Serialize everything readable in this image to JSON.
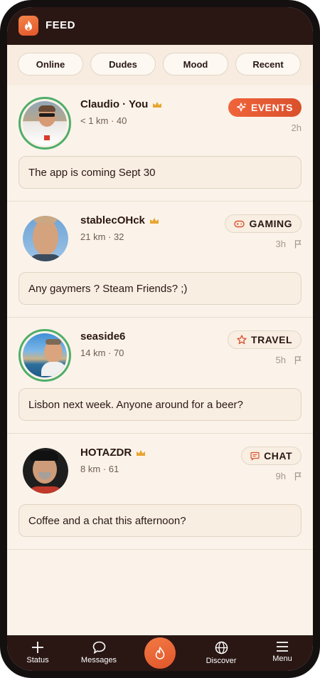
{
  "header": {
    "title": "FEED",
    "logo_icon": "flame-icon"
  },
  "filters": [
    {
      "label": "Online"
    },
    {
      "label": "Dudes"
    },
    {
      "label": "Mood"
    },
    {
      "label": "Recent"
    }
  ],
  "posts": [
    {
      "name": "Claudio · You",
      "meta": "< 1 km · 40",
      "tag": "EVENTS",
      "tag_icon": "sparkle-icon",
      "time": "2h",
      "message": "The app is coming Sept 30",
      "premium": true,
      "online": true
    },
    {
      "name": "stablecOHck",
      "meta": "21 km · 32",
      "tag": "GAMING",
      "tag_icon": "gamepad-icon",
      "time": "3h",
      "message": "Any gaymers ? Steam Friends? ;)",
      "premium": true,
      "online": false
    },
    {
      "name": "seaside6",
      "meta": "14 km · 70",
      "tag": "TRAVEL",
      "tag_icon": "star-outline-icon",
      "time": "5h",
      "message": "Lisbon next week. Anyone around for a beer?",
      "premium": false,
      "online": true
    },
    {
      "name": "HOTAZDR",
      "meta": "8 km · 61",
      "tag": "CHAT",
      "tag_icon": "chat-bubble-icon",
      "time": "9h",
      "message": "Coffee and a chat this afternoon?",
      "premium": true,
      "online": false
    }
  ],
  "nav": [
    {
      "label": "Status",
      "icon": "plus-icon"
    },
    {
      "label": "Messages",
      "icon": "chat-icon"
    },
    {
      "label": "",
      "icon": "flame-icon"
    },
    {
      "label": "Discover",
      "icon": "globe-icon"
    },
    {
      "label": "Menu",
      "icon": "hamburger-icon"
    }
  ],
  "colors": {
    "accent": "#e95f33",
    "dark": "#2a1714",
    "background": "#fbf3e9",
    "online_ring": "#4fae6a",
    "crown": "#e8a531"
  }
}
